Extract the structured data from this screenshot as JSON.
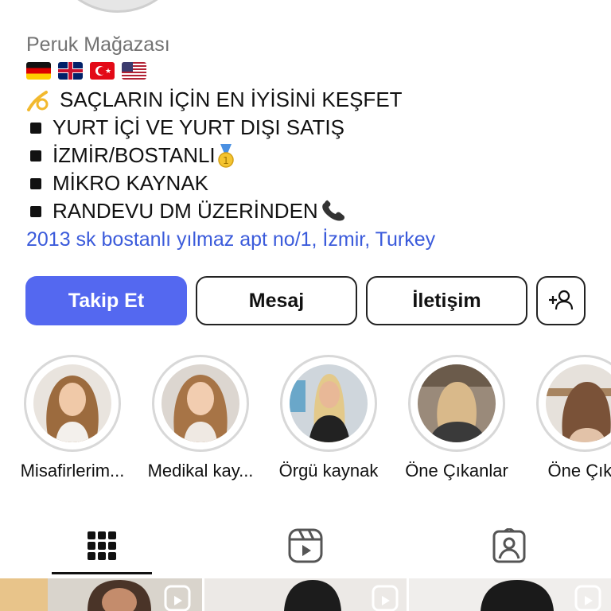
{
  "profile": {
    "category": "Peruk Mağazası",
    "flags": [
      "germany-flag",
      "uk-flag",
      "turkey-flag",
      "usa-flag"
    ],
    "bio": {
      "line1": "SAÇLARIN İÇİN EN İYİSİNİ KEŞFET",
      "line2": "YURT İÇİ VE YURT DIŞI SATIŞ",
      "line3": "İZMİR/BOSTANLI",
      "line4": "MİKRO KAYNAK",
      "line5": "RANDEVU DM ÜZERİNDEN"
    },
    "address": "2013 sk bostanlı yılmaz apt no/1, İzmir, Turkey"
  },
  "actions": {
    "follow": "Takip Et",
    "message": "Mesaj",
    "contact": "İletişim",
    "add_user_icon": "add-person-icon"
  },
  "highlights": [
    {
      "label": "Misafirlerim..."
    },
    {
      "label": "Medikal kay..."
    },
    {
      "label": "Örgü kaynak"
    },
    {
      "label": "Öne Çıkanlar"
    },
    {
      "label": "Öne Çıka"
    }
  ],
  "tabs": [
    {
      "icon": "grid-icon",
      "active": true
    },
    {
      "icon": "reels-icon",
      "active": false
    },
    {
      "icon": "tagged-icon",
      "active": false
    }
  ],
  "colors": {
    "accent": "#5468f0",
    "link": "#3b5bdb",
    "category": "#737373"
  }
}
